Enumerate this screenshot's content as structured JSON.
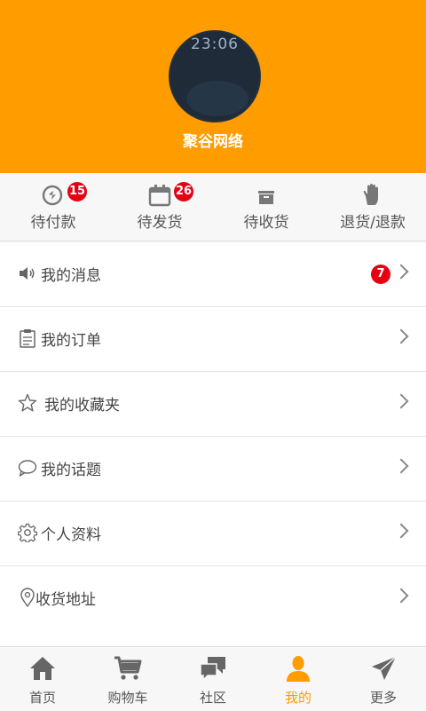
{
  "header": {
    "avatar_time": "23:06",
    "username": "聚谷网络"
  },
  "order_tabs": [
    {
      "label": "待付款",
      "badge": "15",
      "icon": "payment-icon"
    },
    {
      "label": "待发货",
      "badge": "26",
      "icon": "calendar-icon"
    },
    {
      "label": "待收货",
      "badge": "",
      "icon": "box-icon"
    },
    {
      "label": "退货/退款",
      "badge": "",
      "icon": "hand-icon"
    }
  ],
  "menu": [
    {
      "label": "我的消息",
      "badge": "7",
      "icon": "speaker-icon"
    },
    {
      "label": "我的订单",
      "badge": "",
      "icon": "clipboard-icon"
    },
    {
      "label": "我的收藏夹",
      "badge": "",
      "icon": "star-icon"
    },
    {
      "label": "我的话题",
      "badge": "",
      "icon": "chat-bubble-icon"
    },
    {
      "label": "个人资料",
      "badge": "",
      "icon": "gear-icon"
    },
    {
      "label": "收货地址",
      "badge": "",
      "icon": "location-pin-icon"
    }
  ],
  "tabbar": [
    {
      "label": "首页",
      "icon": "home-icon",
      "active": false
    },
    {
      "label": "购物车",
      "icon": "cart-icon",
      "active": false
    },
    {
      "label": "社区",
      "icon": "community-icon",
      "active": false
    },
    {
      "label": "我的",
      "icon": "user-icon",
      "active": true
    },
    {
      "label": "更多",
      "icon": "send-icon",
      "active": false
    }
  ],
  "colors": {
    "accent": "#fe9c00",
    "badge": "#e60012"
  }
}
